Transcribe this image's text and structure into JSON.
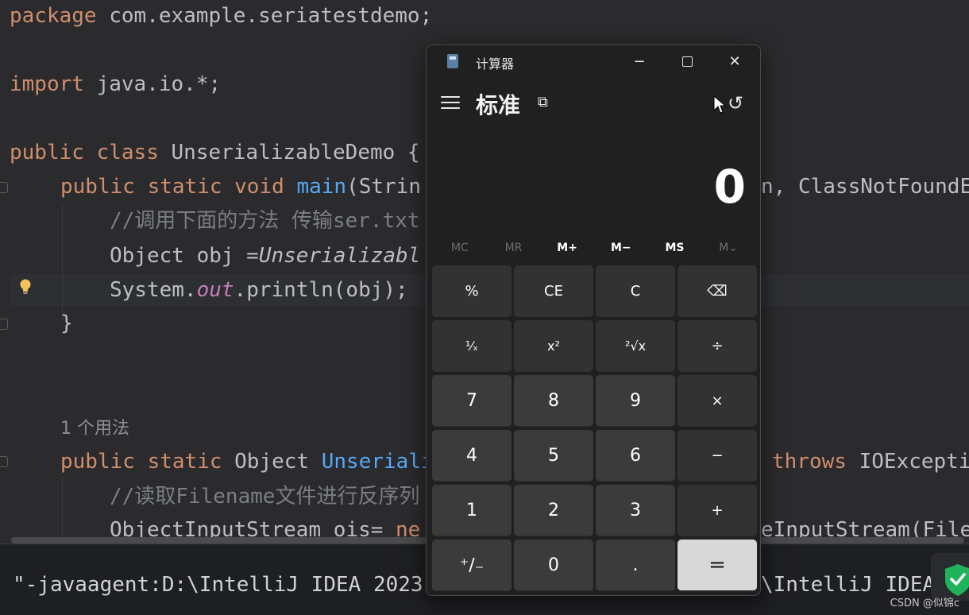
{
  "editor": {
    "lines": {
      "l1_kw": "package",
      "l1_rest": " com.example.seriatestdemo;",
      "l2_kw": "import",
      "l2_rest": " java.io.*;",
      "l3_kw1": "public",
      "l3_kw2": "class",
      "l3_rest": " UnserializableDemo {",
      "l4_kw1": "public",
      "l4_kw2": "static",
      "l4_kw3": "void",
      "l4_fn": "main",
      "l4_rest": "(Strin",
      "l4_tail": "n, ClassNotFoundE",
      "l5_comment": "//调用下面的方法 传输ser.txt",
      "l6_code": "Object obj =",
      "l6_italic": "Unserializabl",
      "l7_sys": "System.",
      "l7_field": "out",
      "l7_rest": ".println(obj);",
      "l8_brace": "}",
      "usage_hint": "1 个用法",
      "l10_kw1": "public",
      "l10_kw2": "static",
      "l10_type": " Object ",
      "l10_fn": "Unseriali",
      "l10_throws": "throws",
      "l10_tail": " IOExcepti",
      "l11_comment": "//读取Filename文件进行反序列",
      "l12_code": "ObjectInputStream ois= ",
      "l12_kw": "ne",
      "l12_tail": "eInputStream(File"
    }
  },
  "console": {
    "line1_left": "\"-javaagent:D:\\IntelliJ IDEA 2023",
    "line1_right": "\\IntelliJ IDEA",
    "line2": "..."
  },
  "watermark": "CSDN @似锦c",
  "calculator": {
    "window_title": "计算器",
    "mode_title": "标准",
    "display_value": "0",
    "memory": [
      "MC",
      "MR",
      "M+",
      "M−",
      "MS",
      "M⌄"
    ],
    "memory_enabled": [
      false,
      false,
      true,
      true,
      true,
      false
    ],
    "keys": [
      {
        "label": "%",
        "kind": "op"
      },
      {
        "label": "CE",
        "kind": "op"
      },
      {
        "label": "C",
        "kind": "op"
      },
      {
        "label": "⌫",
        "kind": "op"
      },
      {
        "label": "¹⁄ₓ",
        "kind": "op"
      },
      {
        "label": "x²",
        "kind": "op"
      },
      {
        "label": "²√x",
        "kind": "op"
      },
      {
        "label": "÷",
        "kind": "op"
      },
      {
        "label": "7",
        "kind": "num"
      },
      {
        "label": "8",
        "kind": "num"
      },
      {
        "label": "9",
        "kind": "num"
      },
      {
        "label": "×",
        "kind": "op"
      },
      {
        "label": "4",
        "kind": "num"
      },
      {
        "label": "5",
        "kind": "num"
      },
      {
        "label": "6",
        "kind": "num"
      },
      {
        "label": "−",
        "kind": "op"
      },
      {
        "label": "1",
        "kind": "num"
      },
      {
        "label": "2",
        "kind": "num"
      },
      {
        "label": "3",
        "kind": "num"
      },
      {
        "label": "+",
        "kind": "op"
      },
      {
        "label": "⁺∕₋",
        "kind": "num"
      },
      {
        "label": "0",
        "kind": "num"
      },
      {
        "label": ".",
        "kind": "num"
      },
      {
        "label": "=",
        "kind": "eq"
      }
    ],
    "key_names": [
      "percent-button",
      "clear-entry-button",
      "clear-button",
      "backspace-button",
      "reciprocal-button",
      "square-button",
      "square-root-button",
      "divide-button",
      "digit-7-button",
      "digit-8-button",
      "digit-9-button",
      "multiply-button",
      "digit-4-button",
      "digit-5-button",
      "digit-6-button",
      "subtract-button",
      "digit-1-button",
      "digit-2-button",
      "digit-3-button",
      "add-button",
      "negate-button",
      "digit-0-button",
      "decimal-button",
      "equals-button"
    ],
    "icons": {
      "minimize": "−",
      "close": "✕",
      "keep_on_top": "⧉",
      "history": "↺"
    }
  },
  "colors": {
    "keyword": "#cf8e6d",
    "function": "#56a8f5",
    "comment": "#7a7e85",
    "equals_key": "#d8d8d8"
  }
}
